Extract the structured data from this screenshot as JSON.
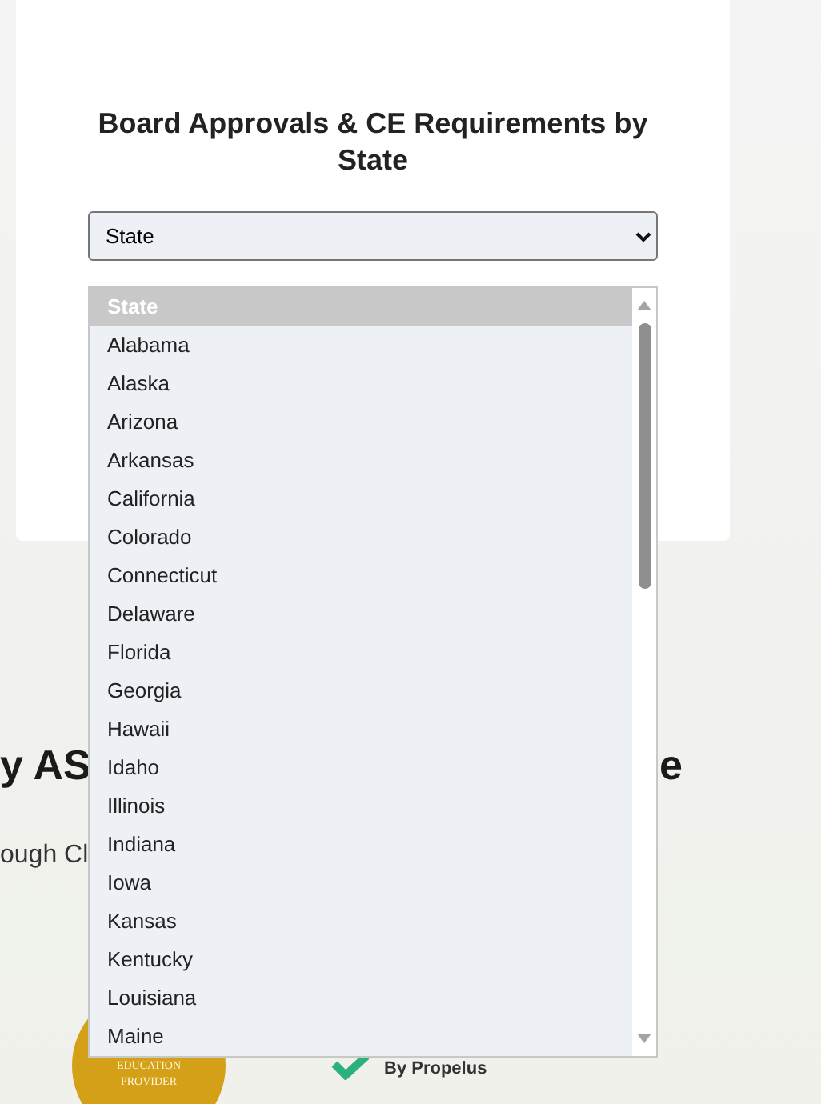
{
  "card": {
    "title": "Board Approvals & CE Requirements by State",
    "select": {
      "value": "State",
      "expanded": true
    }
  },
  "dropdown": {
    "options": [
      {
        "label": "State",
        "selected": true
      },
      {
        "label": "Alabama",
        "selected": false
      },
      {
        "label": "Alaska",
        "selected": false
      },
      {
        "label": "Arizona",
        "selected": false
      },
      {
        "label": "Arkansas",
        "selected": false
      },
      {
        "label": "California",
        "selected": false
      },
      {
        "label": "Colorado",
        "selected": false
      },
      {
        "label": "Connecticut",
        "selected": false
      },
      {
        "label": "Delaware",
        "selected": false
      },
      {
        "label": "Florida",
        "selected": false
      },
      {
        "label": "Georgia",
        "selected": false
      },
      {
        "label": "Hawaii",
        "selected": false
      },
      {
        "label": "Idaho",
        "selected": false
      },
      {
        "label": "Illinois",
        "selected": false
      },
      {
        "label": "Indiana",
        "selected": false
      },
      {
        "label": "Iowa",
        "selected": false
      },
      {
        "label": "Kansas",
        "selected": false
      },
      {
        "label": "Kentucky",
        "selected": false
      },
      {
        "label": "Louisiana",
        "selected": false
      },
      {
        "label": "Maine",
        "selected": false
      }
    ]
  },
  "section": {
    "heading_parts": [
      "y AS",
      "e"
    ],
    "subtext": "ough Cl"
  },
  "logos": {
    "seal_lines": [
      "EDUCATION",
      "PROVIDER"
    ],
    "broker_tagline": "By Propelus"
  }
}
